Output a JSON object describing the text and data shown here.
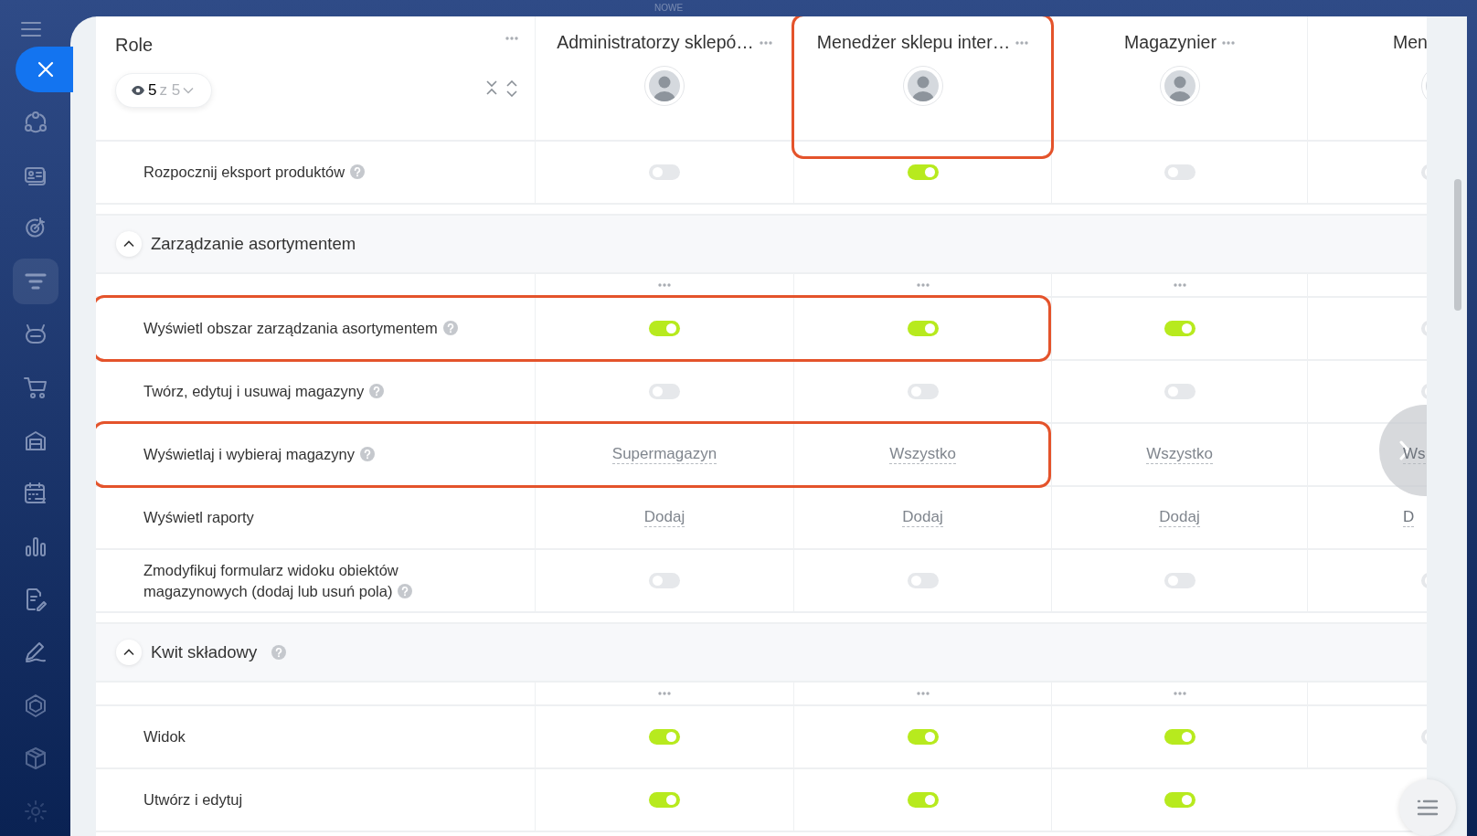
{
  "top_bar": {
    "label": "NOWE"
  },
  "sidebar": {
    "items": [
      {
        "selected": false
      },
      {
        "selected": false
      },
      {
        "selected": false
      },
      {
        "selected": true
      },
      {
        "selected": false
      },
      {
        "selected": false
      },
      {
        "selected": false
      },
      {
        "selected": false
      },
      {
        "selected": false
      },
      {
        "selected": false
      },
      {
        "selected": false
      },
      {
        "selected": false
      },
      {
        "selected": false
      },
      {
        "selected": false
      }
    ]
  },
  "role_header": {
    "title": "Role",
    "shown": "5",
    "of": "z 5"
  },
  "columns": [
    {
      "name": "Administratorzy sklepó…",
      "highlighted": false,
      "menu": true
    },
    {
      "name": "Menedżer sklepu inter…",
      "highlighted": true,
      "menu": true
    },
    {
      "name": "Magazynier",
      "highlighted": false,
      "menu": true
    },
    {
      "name": "Men",
      "highlighted": false,
      "menu": false
    }
  ],
  "rows": [
    {
      "kind": "permission",
      "label": "Rozpocznij eksport produktów",
      "help": true,
      "highlighted": false,
      "cells": [
        {
          "kind": "toggle",
          "on": false
        },
        {
          "kind": "toggle",
          "on": true
        },
        {
          "kind": "toggle",
          "on": false
        },
        {
          "kind": "toggle",
          "on": false
        }
      ]
    },
    {
      "kind": "section",
      "label": "Zarządzanie asortymentem",
      "help": false,
      "expanded": true
    },
    {
      "kind": "menu"
    },
    {
      "kind": "permission",
      "label": "Wyświetl obszar zarządzania asortymentem",
      "help": true,
      "highlighted": true,
      "cells": [
        {
          "kind": "toggle",
          "on": true
        },
        {
          "kind": "toggle",
          "on": true
        },
        {
          "kind": "toggle",
          "on": true
        },
        {
          "kind": "toggle",
          "on": false
        }
      ]
    },
    {
      "kind": "permission",
      "label": "Twórz, edytuj i usuwaj magazyny",
      "help": true,
      "highlighted": false,
      "cells": [
        {
          "kind": "toggle",
          "on": false
        },
        {
          "kind": "toggle",
          "on": false
        },
        {
          "kind": "toggle",
          "on": false
        },
        {
          "kind": "toggle",
          "on": false
        }
      ]
    },
    {
      "kind": "permission",
      "label": "Wyświetlaj i wybieraj magazyny",
      "help": true,
      "highlighted": true,
      "cells": [
        {
          "kind": "value",
          "text": "Supermagazyn"
        },
        {
          "kind": "value",
          "text": "Wszystko"
        },
        {
          "kind": "value",
          "text": "Wszystko"
        },
        {
          "kind": "value",
          "text": "Ws"
        }
      ]
    },
    {
      "kind": "permission",
      "label": "Wyświetl raporty",
      "help": false,
      "highlighted": false,
      "cells": [
        {
          "kind": "value",
          "text": "Dodaj"
        },
        {
          "kind": "value",
          "text": "Dodaj"
        },
        {
          "kind": "value",
          "text": "Dodaj"
        },
        {
          "kind": "value",
          "text": "D"
        }
      ]
    },
    {
      "kind": "permission",
      "label": "Zmodyfikuj formularz widoku obiektów magazynowych (dodaj lub usuń pola)",
      "help": true,
      "highlighted": false,
      "cells": [
        {
          "kind": "toggle",
          "on": false
        },
        {
          "kind": "toggle",
          "on": false
        },
        {
          "kind": "toggle",
          "on": false
        },
        {
          "kind": "toggle",
          "on": false
        }
      ]
    },
    {
      "kind": "section",
      "label": "Kwit składowy",
      "help": true,
      "expanded": true
    },
    {
      "kind": "menu"
    },
    {
      "kind": "permission",
      "label": "Widok",
      "help": false,
      "highlighted": false,
      "cells": [
        {
          "kind": "toggle",
          "on": true
        },
        {
          "kind": "toggle",
          "on": true
        },
        {
          "kind": "toggle",
          "on": true
        },
        {
          "kind": "toggle",
          "on": false
        }
      ]
    },
    {
      "kind": "permission",
      "label": "Utwórz i edytuj",
      "help": false,
      "highlighted": false,
      "cells": [
        {
          "kind": "toggle",
          "on": true
        },
        {
          "kind": "toggle",
          "on": true
        },
        {
          "kind": "toggle",
          "on": true
        }
      ]
    }
  ]
}
